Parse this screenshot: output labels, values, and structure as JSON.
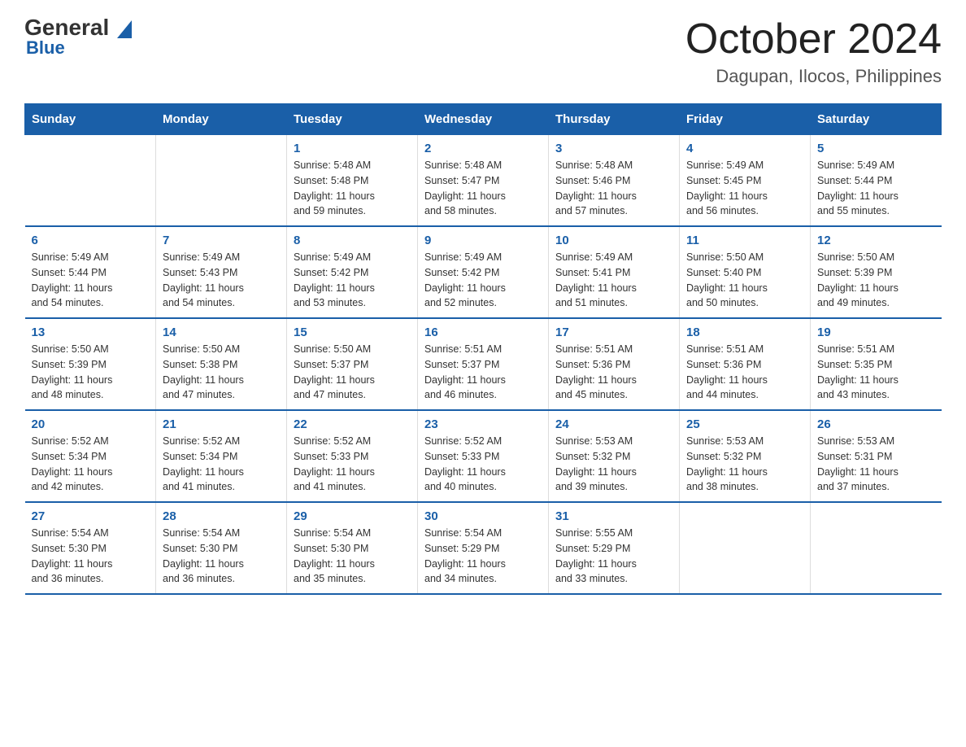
{
  "logo": {
    "text_general": "General",
    "triangle_color": "#1a5fa8",
    "text_blue": "Blue"
  },
  "title": "October 2024",
  "subtitle": "Dagupan, Ilocos, Philippines",
  "days_of_week": [
    "Sunday",
    "Monday",
    "Tuesday",
    "Wednesday",
    "Thursday",
    "Friday",
    "Saturday"
  ],
  "weeks": [
    [
      {
        "day": "",
        "info": ""
      },
      {
        "day": "",
        "info": ""
      },
      {
        "day": "1",
        "info": "Sunrise: 5:48 AM\nSunset: 5:48 PM\nDaylight: 11 hours\nand 59 minutes."
      },
      {
        "day": "2",
        "info": "Sunrise: 5:48 AM\nSunset: 5:47 PM\nDaylight: 11 hours\nand 58 minutes."
      },
      {
        "day": "3",
        "info": "Sunrise: 5:48 AM\nSunset: 5:46 PM\nDaylight: 11 hours\nand 57 minutes."
      },
      {
        "day": "4",
        "info": "Sunrise: 5:49 AM\nSunset: 5:45 PM\nDaylight: 11 hours\nand 56 minutes."
      },
      {
        "day": "5",
        "info": "Sunrise: 5:49 AM\nSunset: 5:44 PM\nDaylight: 11 hours\nand 55 minutes."
      }
    ],
    [
      {
        "day": "6",
        "info": "Sunrise: 5:49 AM\nSunset: 5:44 PM\nDaylight: 11 hours\nand 54 minutes."
      },
      {
        "day": "7",
        "info": "Sunrise: 5:49 AM\nSunset: 5:43 PM\nDaylight: 11 hours\nand 54 minutes."
      },
      {
        "day": "8",
        "info": "Sunrise: 5:49 AM\nSunset: 5:42 PM\nDaylight: 11 hours\nand 53 minutes."
      },
      {
        "day": "9",
        "info": "Sunrise: 5:49 AM\nSunset: 5:42 PM\nDaylight: 11 hours\nand 52 minutes."
      },
      {
        "day": "10",
        "info": "Sunrise: 5:49 AM\nSunset: 5:41 PM\nDaylight: 11 hours\nand 51 minutes."
      },
      {
        "day": "11",
        "info": "Sunrise: 5:50 AM\nSunset: 5:40 PM\nDaylight: 11 hours\nand 50 minutes."
      },
      {
        "day": "12",
        "info": "Sunrise: 5:50 AM\nSunset: 5:39 PM\nDaylight: 11 hours\nand 49 minutes."
      }
    ],
    [
      {
        "day": "13",
        "info": "Sunrise: 5:50 AM\nSunset: 5:39 PM\nDaylight: 11 hours\nand 48 minutes."
      },
      {
        "day": "14",
        "info": "Sunrise: 5:50 AM\nSunset: 5:38 PM\nDaylight: 11 hours\nand 47 minutes."
      },
      {
        "day": "15",
        "info": "Sunrise: 5:50 AM\nSunset: 5:37 PM\nDaylight: 11 hours\nand 47 minutes."
      },
      {
        "day": "16",
        "info": "Sunrise: 5:51 AM\nSunset: 5:37 PM\nDaylight: 11 hours\nand 46 minutes."
      },
      {
        "day": "17",
        "info": "Sunrise: 5:51 AM\nSunset: 5:36 PM\nDaylight: 11 hours\nand 45 minutes."
      },
      {
        "day": "18",
        "info": "Sunrise: 5:51 AM\nSunset: 5:36 PM\nDaylight: 11 hours\nand 44 minutes."
      },
      {
        "day": "19",
        "info": "Sunrise: 5:51 AM\nSunset: 5:35 PM\nDaylight: 11 hours\nand 43 minutes."
      }
    ],
    [
      {
        "day": "20",
        "info": "Sunrise: 5:52 AM\nSunset: 5:34 PM\nDaylight: 11 hours\nand 42 minutes."
      },
      {
        "day": "21",
        "info": "Sunrise: 5:52 AM\nSunset: 5:34 PM\nDaylight: 11 hours\nand 41 minutes."
      },
      {
        "day": "22",
        "info": "Sunrise: 5:52 AM\nSunset: 5:33 PM\nDaylight: 11 hours\nand 41 minutes."
      },
      {
        "day": "23",
        "info": "Sunrise: 5:52 AM\nSunset: 5:33 PM\nDaylight: 11 hours\nand 40 minutes."
      },
      {
        "day": "24",
        "info": "Sunrise: 5:53 AM\nSunset: 5:32 PM\nDaylight: 11 hours\nand 39 minutes."
      },
      {
        "day": "25",
        "info": "Sunrise: 5:53 AM\nSunset: 5:32 PM\nDaylight: 11 hours\nand 38 minutes."
      },
      {
        "day": "26",
        "info": "Sunrise: 5:53 AM\nSunset: 5:31 PM\nDaylight: 11 hours\nand 37 minutes."
      }
    ],
    [
      {
        "day": "27",
        "info": "Sunrise: 5:54 AM\nSunset: 5:30 PM\nDaylight: 11 hours\nand 36 minutes."
      },
      {
        "day": "28",
        "info": "Sunrise: 5:54 AM\nSunset: 5:30 PM\nDaylight: 11 hours\nand 36 minutes."
      },
      {
        "day": "29",
        "info": "Sunrise: 5:54 AM\nSunset: 5:30 PM\nDaylight: 11 hours\nand 35 minutes."
      },
      {
        "day": "30",
        "info": "Sunrise: 5:54 AM\nSunset: 5:29 PM\nDaylight: 11 hours\nand 34 minutes."
      },
      {
        "day": "31",
        "info": "Sunrise: 5:55 AM\nSunset: 5:29 PM\nDaylight: 11 hours\nand 33 minutes."
      },
      {
        "day": "",
        "info": ""
      },
      {
        "day": "",
        "info": ""
      }
    ]
  ]
}
